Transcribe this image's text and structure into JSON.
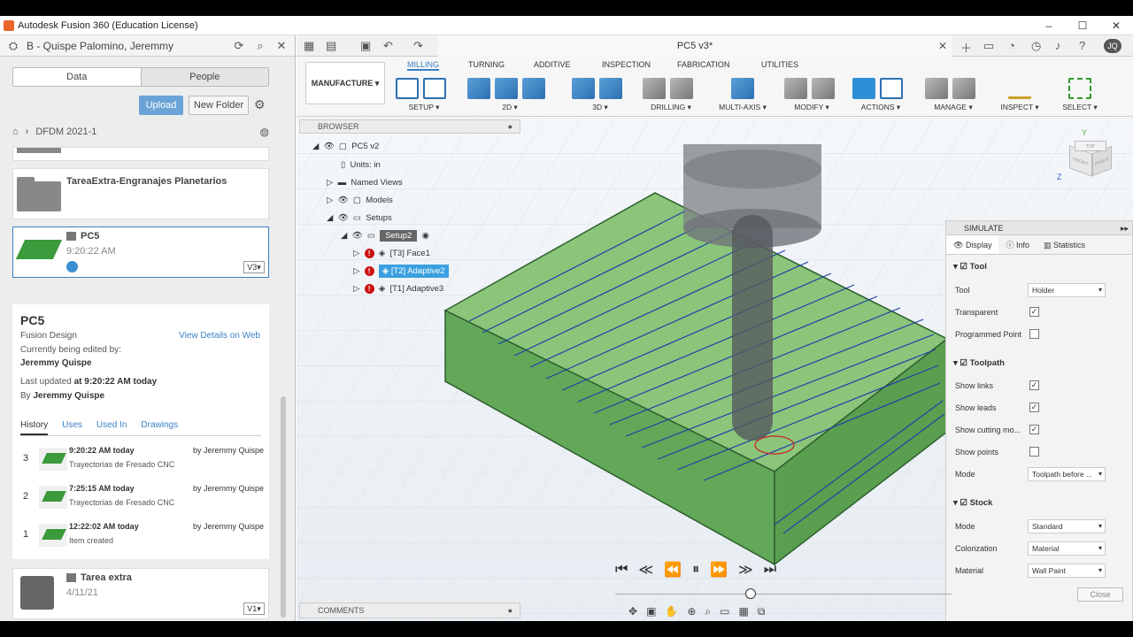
{
  "window": {
    "title": "Autodesk Fusion 360 (Education License)",
    "controls": [
      "–",
      "☐",
      "✕"
    ]
  },
  "left_panel": {
    "team": "B - Quispe Palomino, Jeremmy",
    "tabs": [
      "Data",
      "People"
    ],
    "upload": "Upload",
    "new_folder": "New Folder",
    "path": "DFDM 2021-1",
    "items": [
      {
        "name": "TareaExtra-Engranajes Planetarios"
      },
      {
        "name": "PC5",
        "date": "9:20:22 AM",
        "version": "V3▾"
      },
      {
        "name": "Tarea extra",
        "date": "4/11/21",
        "version": "V1▾"
      }
    ],
    "details": {
      "name": "PC5",
      "type": "Fusion Design",
      "view_web": "View Details on Web",
      "editing_label": "Currently being edited by:",
      "editor": "Jeremmy Quispe",
      "updated_label": "Last updated",
      "updated_value": "at 9:20:22 AM today",
      "by_label": "By",
      "by_value": "Jeremmy Quispe",
      "tabs": [
        "History",
        "Uses",
        "Used In",
        "Drawings"
      ],
      "history": [
        {
          "num": "3",
          "time": "9:20:22 AM today",
          "desc": "Trayectorias de Fresado CNC",
          "by": "by Jeremmy Quispe"
        },
        {
          "num": "2",
          "time": "7:25:15 AM today",
          "desc": "Trayectorias de Fresado CNC",
          "by": "by Jeremmy Quispe"
        },
        {
          "num": "1",
          "time": "12:22:02 AM today",
          "desc": "Item created",
          "by": "by Jeremmy Quispe"
        }
      ]
    }
  },
  "doc": {
    "tab": "PC5 v3*"
  },
  "toolbar": {
    "workspace": "MANUFACTURE ▾",
    "tabs": [
      "MILLING",
      "TURNING",
      "ADDITIVE",
      "INSPECTION",
      "FABRICATION",
      "UTILITIES"
    ],
    "groups": [
      "SETUP ▾",
      "2D ▾",
      "3D ▾",
      "DRILLING ▾",
      "MULTI-AXIS ▾",
      "MODIFY ▾",
      "ACTIONS ▾",
      "MANAGE ▾",
      "INSPECT ▾",
      "SELECT ▾"
    ]
  },
  "browser": {
    "title": "BROWSER",
    "root": "PC5 v2",
    "units": "Units: in",
    "named_views": "Named Views",
    "models": "Models",
    "setups": "Setups",
    "setup2": "Setup2",
    "ops": [
      "[T3] Face1",
      "[T2] Adaptive2",
      "[T1] Adaptive3"
    ]
  },
  "simulate": {
    "title": "SIMULATE",
    "tabs": [
      "Display",
      "Info",
      "Statistics"
    ],
    "tool_section": "Tool",
    "tool_label": "Tool",
    "tool_value": "Holder",
    "transparent": "Transparent",
    "programmed_point": "Programmed Point",
    "toolpath_section": "Toolpath",
    "show_links": "Show links",
    "show_leads": "Show leads",
    "show_cutting": "Show cutting mo...",
    "show_points": "Show points",
    "mode_label": "Mode",
    "mode_value": "Toolpath before ...",
    "stock_section": "Stock",
    "stock_mode_label": "Mode",
    "stock_mode_value": "Standard",
    "colorization_label": "Colorization",
    "colorization_value": "Material",
    "material_label": "Material",
    "material_value": "Wall Paint",
    "close": "Close"
  },
  "comments": "COMMENTS",
  "viewcube": {
    "front": "FRONT",
    "right": "RIGHT",
    "top": "TOP",
    "axis_z": "Z",
    "axis_y": "Y"
  }
}
